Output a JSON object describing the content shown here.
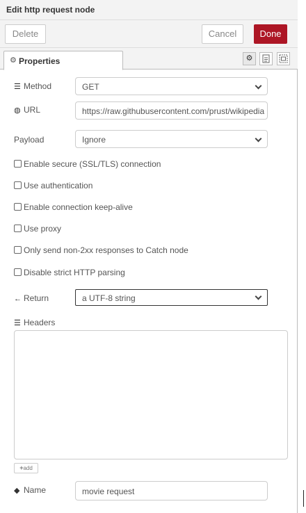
{
  "window": {
    "title": "Edit http request node"
  },
  "toolbar": {
    "delete_label": "Delete",
    "cancel_label": "Cancel",
    "done_label": "Done"
  },
  "tabs": {
    "properties_label": "Properties",
    "properties_icon": "gear-icon",
    "icons": [
      "gear-icon",
      "description-icon",
      "appearance-icon"
    ]
  },
  "form": {
    "method": {
      "label": "Method",
      "icon": "tasks-icon",
      "value": "GET"
    },
    "url": {
      "label": "URL",
      "icon": "globe-icon",
      "value": "https://raw.githubusercontent.com/prust/wikipedia-"
    },
    "payload": {
      "label": "Payload",
      "value": "Ignore"
    },
    "checkboxes": [
      {
        "label": "Enable secure (SSL/TLS) connection",
        "checked": false
      },
      {
        "label": "Use authentication",
        "checked": false
      },
      {
        "label": "Enable connection keep-alive",
        "checked": false
      },
      {
        "label": "Use proxy",
        "checked": false
      },
      {
        "label": "Only send non-2xx responses to Catch node",
        "checked": false
      },
      {
        "label": "Disable strict HTTP parsing",
        "checked": false
      }
    ],
    "return": {
      "label": "Return",
      "icon": "arrow-left-icon",
      "value": "a UTF-8 string"
    },
    "headers": {
      "label": "Headers",
      "icon": "list-icon",
      "add_label": "add"
    },
    "name": {
      "label": "Name",
      "icon": "tag-icon",
      "value": "movie request"
    }
  },
  "colors": {
    "accent": "#ad1625",
    "border": "#cccccc",
    "panel": "#f3f3f3"
  }
}
